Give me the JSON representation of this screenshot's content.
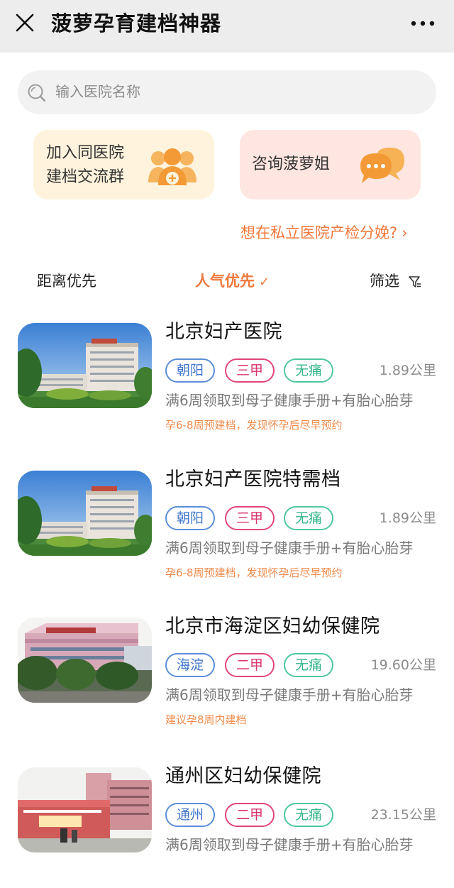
{
  "header": {
    "title": "菠萝孕育建档神器",
    "close_icon": "close-icon",
    "more_icon": "more-icon"
  },
  "search": {
    "placeholder": "输入医院名称",
    "icon": "search-icon"
  },
  "cards": {
    "group": {
      "line1": "加入同医院",
      "line2": "建档交流群",
      "icon": "group-add-icon",
      "bg": "#fff3dd",
      "icon_color": "#f39a36"
    },
    "consult": {
      "label": "咨询菠萝姐",
      "icon": "chat-bubbles-icon",
      "bg": "#ffe6e0",
      "icon_color": "#f39a36"
    }
  },
  "promo": {
    "label": "想在私立医院产检分娩?",
    "arrow": "›"
  },
  "sort": {
    "distance": "距离优先",
    "popular": "人气优先",
    "popular_check": "✓",
    "filter": "筛选",
    "active_color": "#f0783c"
  },
  "hospitals": [
    {
      "name": "北京妇产医院",
      "district": "朝阳",
      "level": "三甲",
      "painless": "无痛",
      "distance": "1.89公里",
      "desc": "满6周领取到母子健康手册+有胎心胎芽",
      "tip": "孕6-8周预建档，发现怀孕后尽早预约",
      "image": "hospital-building-photo"
    },
    {
      "name": "北京妇产医院特需档",
      "district": "朝阳",
      "level": "三甲",
      "painless": "无痛",
      "distance": "1.89公里",
      "desc": "满6周领取到母子健康手册+有胎心胎芽",
      "tip": "孕6-8周预建档，发现怀孕后尽早预约",
      "image": "hospital-building-photo"
    },
    {
      "name": "北京市海淀区妇幼保健院",
      "district": "海淀",
      "level": "二甲",
      "painless": "无痛",
      "distance": "19.60公里",
      "desc": "满6周领取到母子健康手册+有胎心胎芽",
      "tip": "建议孕8周内建档",
      "image": "hospital-building-photo"
    },
    {
      "name": "通州区妇幼保健院",
      "district": "通州",
      "level": "二甲",
      "painless": "无痛",
      "distance": "23.15公里",
      "desc": "满6周领取到母子健康手册+有胎心胎芽",
      "tip": "",
      "image": "hospital-building-photo"
    }
  ]
}
